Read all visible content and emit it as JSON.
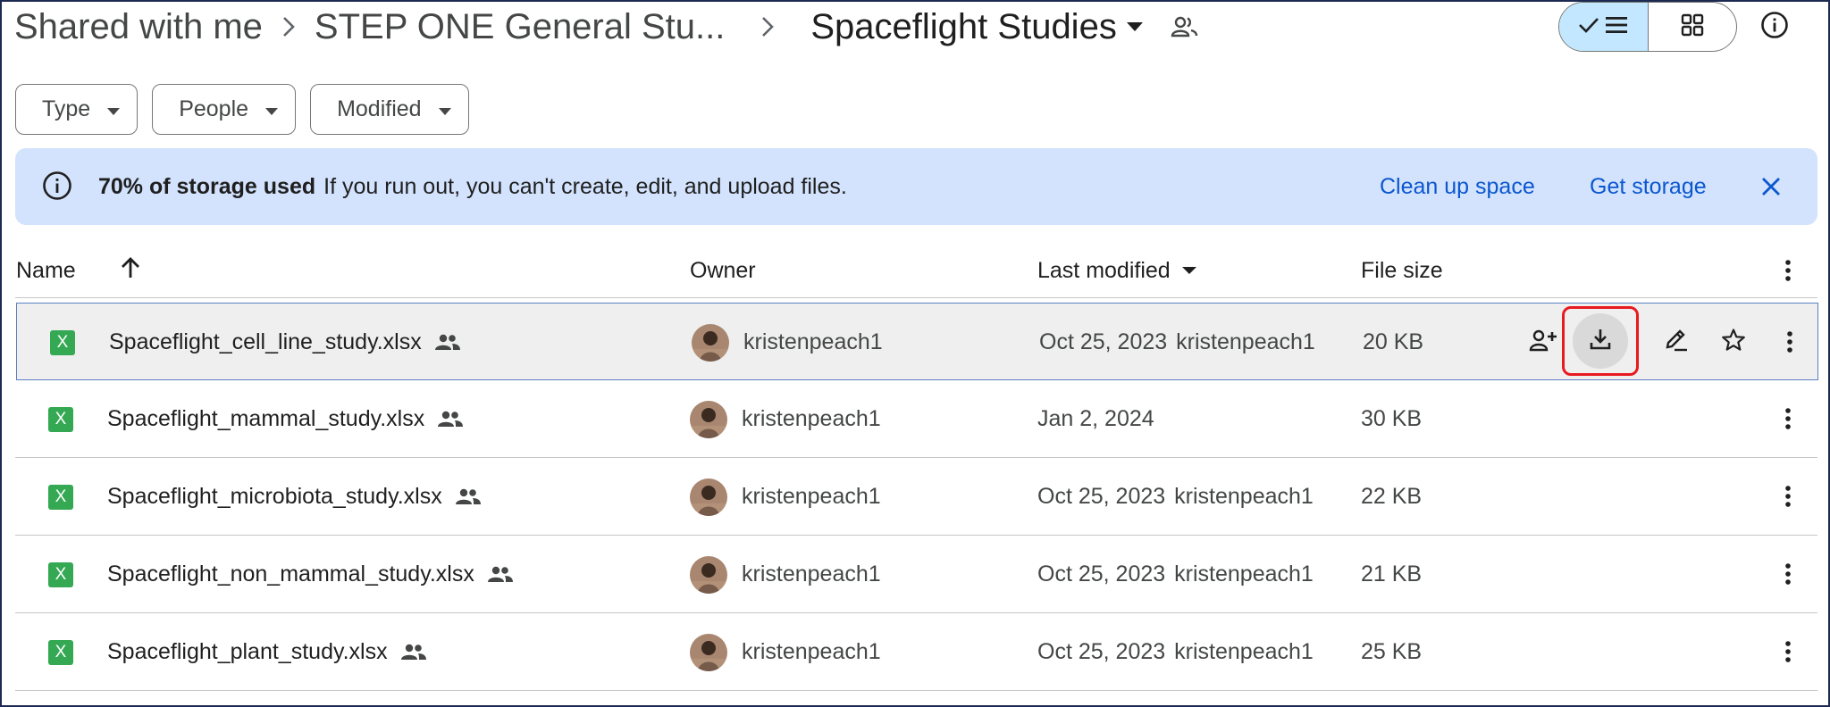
{
  "breadcrumb": {
    "items": [
      "Shared with me",
      "STEP ONE General Stu..."
    ],
    "current": "Spaceflight Studies"
  },
  "view_toggle": {
    "selected": "list"
  },
  "filters": [
    "Type",
    "People",
    "Modified"
  ],
  "banner": {
    "bold": "70% of storage used",
    "message": "If you run out, you can't create, edit, and upload files.",
    "clean_up": "Clean up space",
    "get_storage": "Get storage"
  },
  "columns": {
    "name": "Name",
    "owner": "Owner",
    "last_modified": "Last modified",
    "file_size": "File size"
  },
  "files": [
    {
      "name": "Spaceflight_cell_line_study.xlsx",
      "owner": "kristenpeach1",
      "modified": "Oct 25, 2023",
      "modified_by": "kristenpeach1",
      "size": "20 KB"
    },
    {
      "name": "Spaceflight_mammal_study.xlsx",
      "owner": "kristenpeach1",
      "modified": "Jan 2, 2024",
      "modified_by": "",
      "size": "30 KB"
    },
    {
      "name": "Spaceflight_microbiota_study.xlsx",
      "owner": "kristenpeach1",
      "modified": "Oct 25, 2023",
      "modified_by": "kristenpeach1",
      "size": "22 KB"
    },
    {
      "name": "Spaceflight_non_mammal_study.xlsx",
      "owner": "kristenpeach1",
      "modified": "Oct 25, 2023",
      "modified_by": "kristenpeach1",
      "size": "21 KB"
    },
    {
      "name": "Spaceflight_plant_study.xlsx",
      "owner": "kristenpeach1",
      "modified": "Oct 25, 2023",
      "modified_by": "kristenpeach1",
      "size": "25 KB"
    }
  ],
  "file_icon_letter": "X",
  "colors": {
    "accent_link": "#0b57d0",
    "banner_bg": "#d3e3fd",
    "toggle_selected": "#c2e7ff",
    "excel_green": "#34a853",
    "highlight_red": "#e8191f"
  },
  "icons": {
    "breadcrumb_separator": "chevron-right-icon",
    "shared_folder": "people-outline-icon",
    "list_view": "check-list-icon",
    "grid_view": "grid-icon",
    "details": "info-icon",
    "sort": "arrow-up-icon",
    "row_actions": [
      "add-person-icon",
      "download-icon",
      "rename-pencil-icon",
      "star-icon"
    ],
    "more": "more-vertical-icon"
  },
  "selected_row": 0
}
